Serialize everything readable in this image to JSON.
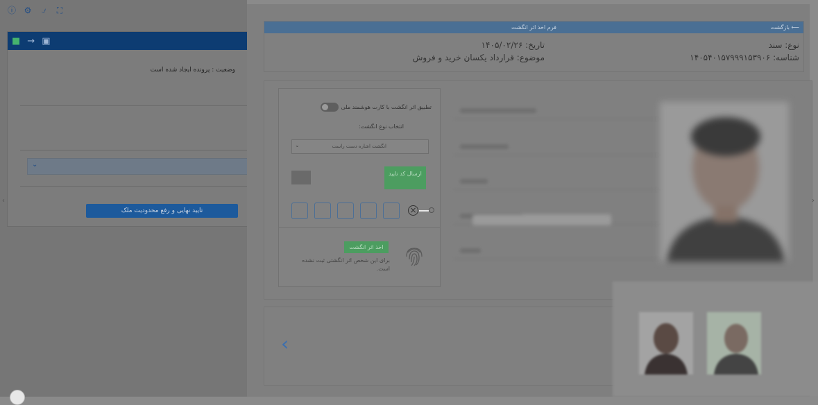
{
  "left_app": {
    "top_icons": [
      "help-icon",
      "gear-icon",
      "bell-icon",
      "fullscreen-icon"
    ],
    "toolbar_icons": [
      "save-icon",
      "arrow-right-icon",
      "folder-icon"
    ],
    "status_text": "وضعیت : پرونده ایجاد شده است",
    "final_button": "تایید نهایی و رفع محدودیت ملک"
  },
  "modal": {
    "header": {
      "back_label": "⟵ بازگشت",
      "title": "فرم اخذ اثر انگشت"
    },
    "info": {
      "doc_type_label": "نوع: سند",
      "id_label": "شناسه: ۱۴۰۵۴۰۱۵۷۹۹۹۱۵۳۹۰۶",
      "date_label": "تاریخ: ۱۴۰۵/۰۲/۲۶",
      "subject_label": "موضوع: قرارداد یکسان خرید و فروش"
    },
    "fingerprint": {
      "smart_card_toggle_label": "تطبیق اثر انگشت با کارت هوشمند ملی",
      "finger_type_label": "انتخاب نوع انگشت:",
      "finger_type_value": "انگشت اشاره دست راست",
      "send_code_label": "ارسال کد تایید",
      "take_button": "اخذ اثر انگشت",
      "no_print_text": "برای این شخص اثر انگشتی ثبت نشده است."
    },
    "otp_count": 5
  },
  "colors": {
    "header_blue": "#4a6f94",
    "green_button": "#4c9d60",
    "dark_blue": "#0d3c72",
    "accent_blue": "#3a6fb0"
  }
}
